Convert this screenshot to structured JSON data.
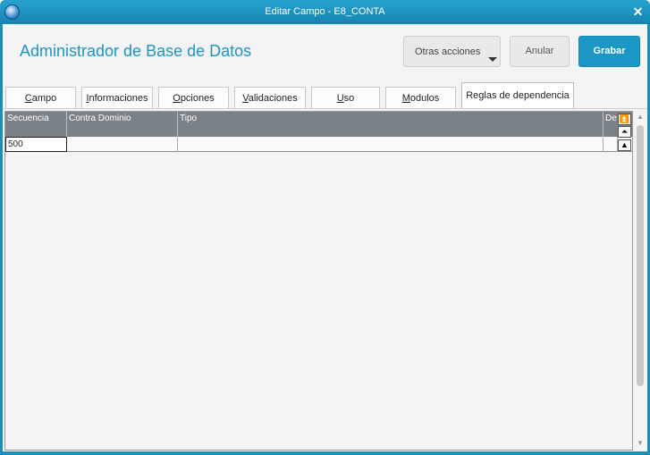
{
  "window": {
    "title": "Editar Campo - E8_CONTA",
    "close_glyph": "✕",
    "icon": "app-globe-icon"
  },
  "header": {
    "app_title": "Administrador de Base de Datos",
    "buttons": {
      "otras_acciones": "Otras acciones",
      "anular": "Anular",
      "grabar": "Grabar"
    }
  },
  "tabs": [
    {
      "label_first": "C",
      "label_rest": "ampo"
    },
    {
      "label_first": "I",
      "label_rest": "nformaciones"
    },
    {
      "label_first": "O",
      "label_rest": "pciones"
    },
    {
      "label_first": "V",
      "label_rest": "alidaciones"
    },
    {
      "label_first": "U",
      "label_rest": "so"
    },
    {
      "label_first": "M",
      "label_rest": "odulos"
    },
    {
      "label": "Reglas de dependencia",
      "active": true
    }
  ],
  "grid": {
    "columns": [
      "Secuencia",
      "Contra Dominio",
      "Tipo",
      "De"
    ],
    "rows": [
      {
        "secuencia": "500",
        "contra_dominio": "",
        "tipo": "",
        "de": ""
      }
    ]
  },
  "colors": {
    "accent": "#1b97c6",
    "title_text": "#1e94c4",
    "grid_header": "#7a8287",
    "titlebar": "#1c8fb7"
  }
}
